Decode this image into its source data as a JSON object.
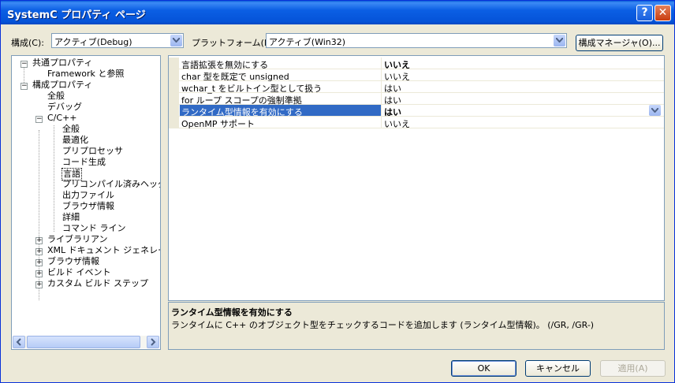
{
  "window": {
    "title": "SystemC プロパティ ページ",
    "help_glyph": "?",
    "close_glyph": "✕"
  },
  "toolbar": {
    "config_label": "構成(C):",
    "config_value": "アクティブ(Debug)",
    "platform_label": "プラットフォーム(P):",
    "platform_value": "アクティブ(Win32)",
    "manager_button": "構成マネージャ(O)..."
  },
  "tree": {
    "common": "共通プロパティ",
    "framework": "Framework と参照",
    "config": "構成プロパティ",
    "general": "全般",
    "debug": "デバッグ",
    "cpp": "C/C++",
    "cpp_items": [
      "全般",
      "最適化",
      "プリプロセッサ",
      "コード生成",
      "言語",
      "プリコンパイル済みヘッダー",
      "出力ファイル",
      "ブラウザ情報",
      "詳細",
      "コマンド ライン"
    ],
    "collapsed": [
      "ライブラリアン",
      "XML ドキュメント ジェネレータ",
      "ブラウザ情報",
      "ビルド イベント",
      "カスタム ビルド ステップ"
    ],
    "toggle_minus": "−",
    "toggle_plus": "+"
  },
  "properties": [
    {
      "name": "言語拡張を無効にする",
      "value": "いいえ",
      "bold": true
    },
    {
      "name": "char 型を既定で unsigned",
      "value": "いいえ",
      "bold": false
    },
    {
      "name": "wchar_t をビルトイン型として扱う",
      "value": "はい",
      "bold": false
    },
    {
      "name": "for ループ スコープの強制準拠",
      "value": "はい",
      "bold": false
    },
    {
      "name": "ランタイム型情報を有効にする",
      "value": "はい",
      "bold": true,
      "selected": true
    },
    {
      "name": "OpenMP サポート",
      "value": "いいえ",
      "bold": false
    }
  ],
  "description": {
    "title": "ランタイム型情報を有効にする",
    "text": "ランタイムに C++ のオブジェクト型をチェックするコードを追加します (ランタイム型情報)。    (/GR, /GR-)"
  },
  "buttons": {
    "ok": "OK",
    "cancel": "キャンセル",
    "apply": "適用(A)"
  },
  "colors": {
    "title_bar": "#0553d8",
    "selection": "#316ac5",
    "dialog_bg": "#ece9d8",
    "border": "#7f9db9"
  }
}
